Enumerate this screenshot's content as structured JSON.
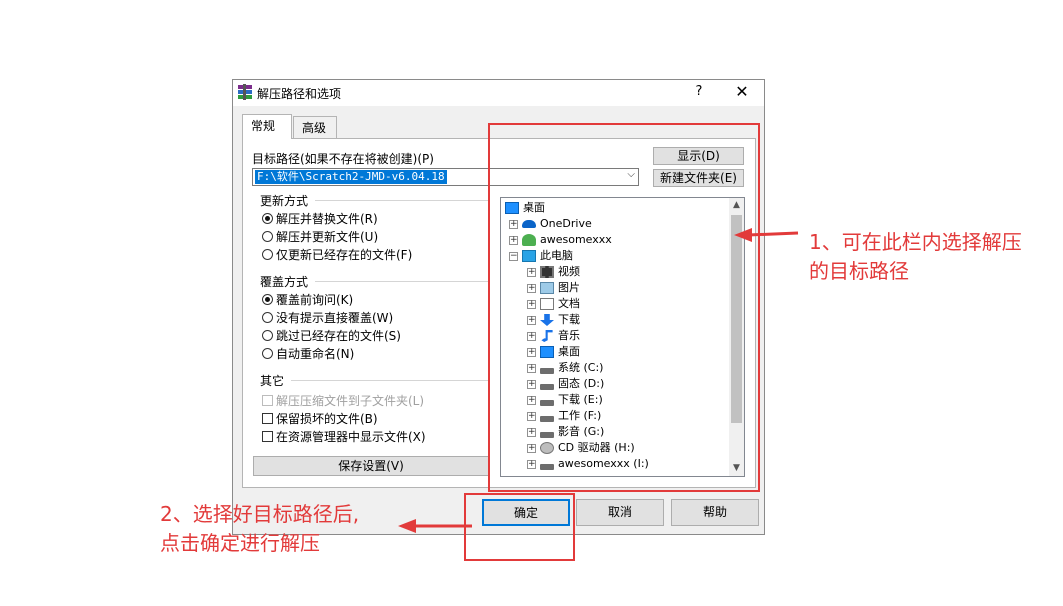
{
  "dialog": {
    "title": "解压路径和选项",
    "help_glyph": "?",
    "close_glyph": "✕",
    "tabs": [
      {
        "label": "常规",
        "active": true
      },
      {
        "label": "高级",
        "active": false
      }
    ],
    "path_label": "目标路径(如果不存在将被创建)(P)",
    "path_value": "F:\\软件\\Scratch2-JMD-v6.04.18",
    "show_button": "显示(D)",
    "new_folder_button": "新建文件夹(E)",
    "update_group": {
      "title": "更新方式",
      "options": [
        {
          "label": "解压并替换文件(R)",
          "selected": true
        },
        {
          "label": "解压并更新文件(U)",
          "selected": false
        },
        {
          "label": "仅更新已经存在的文件(F)",
          "selected": false
        }
      ]
    },
    "overwrite_group": {
      "title": "覆盖方式",
      "options": [
        {
          "label": "覆盖前询问(K)",
          "selected": true
        },
        {
          "label": "没有提示直接覆盖(W)",
          "selected": false
        },
        {
          "label": "跳过已经存在的文件(S)",
          "selected": false
        },
        {
          "label": "自动重命名(N)",
          "selected": false
        }
      ]
    },
    "other_group": {
      "title": "其它",
      "options": [
        {
          "label": "解压压缩文件到子文件夹(L)",
          "checked": false,
          "disabled": true
        },
        {
          "label": "保留损坏的文件(B)",
          "checked": false,
          "disabled": false
        },
        {
          "label": "在资源管理器中显示文件(X)",
          "checked": false,
          "disabled": false
        }
      ]
    },
    "save_settings_button": "保存设置(V)",
    "tree": [
      {
        "label": "桌面",
        "icon": "desktop-icon",
        "level": 0,
        "expander": ""
      },
      {
        "label": "OneDrive",
        "icon": "cloud-icon",
        "level": 1,
        "expander": "+"
      },
      {
        "label": "awesomexxx",
        "icon": "user-icon",
        "level": 1,
        "expander": "+"
      },
      {
        "label": "此电脑",
        "icon": "pc-icon",
        "level": 1,
        "expander": "−"
      },
      {
        "label": "视频",
        "icon": "video-icon",
        "level": 2,
        "expander": "+"
      },
      {
        "label": "图片",
        "icon": "picture-icon",
        "level": 2,
        "expander": "+"
      },
      {
        "label": "文档",
        "icon": "document-icon",
        "level": 2,
        "expander": "+"
      },
      {
        "label": "下载",
        "icon": "download-icon",
        "level": 2,
        "expander": "+"
      },
      {
        "label": "音乐",
        "icon": "music-icon",
        "level": 2,
        "expander": "+"
      },
      {
        "label": "桌面",
        "icon": "desktop-icon",
        "level": 2,
        "expander": "+"
      },
      {
        "label": "系统 (C:)",
        "icon": "drive-icon",
        "level": 2,
        "expander": "+"
      },
      {
        "label": "固态 (D:)",
        "icon": "drive-icon",
        "level": 2,
        "expander": "+"
      },
      {
        "label": "下载 (E:)",
        "icon": "drive-icon",
        "level": 2,
        "expander": "+"
      },
      {
        "label": "工作 (F:)",
        "icon": "drive-icon",
        "level": 2,
        "expander": "+"
      },
      {
        "label": "影音 (G:)",
        "icon": "drive-icon",
        "level": 2,
        "expander": "+"
      },
      {
        "label": "CD 驱动器 (H:)",
        "icon": "cd-icon",
        "level": 2,
        "expander": "+"
      },
      {
        "label": "awesomexxx (I:)",
        "icon": "drive-icon",
        "level": 2,
        "expander": "+"
      }
    ],
    "ok_button": "确定",
    "cancel_button": "取消",
    "help_button": "帮助"
  },
  "annotations": {
    "note1_line1": "1、可在此栏内选择解压",
    "note1_line2": "的目标路径",
    "note2_line1": "2、选择好目标路径后,",
    "note2_line2": "点击确定进行解压",
    "color": "#e23a3a"
  }
}
